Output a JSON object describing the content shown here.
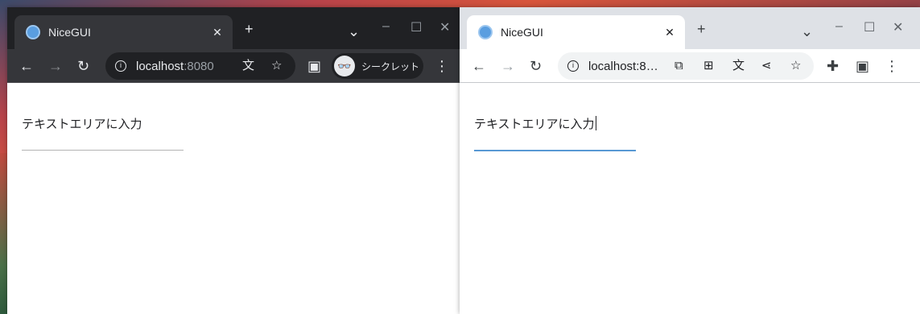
{
  "left_window": {
    "tab_title": "NiceGUI",
    "url_host": "localhost",
    "url_port": ":8080",
    "incognito_label": "シークレット",
    "textarea_label": "テキストエリアに入力"
  },
  "right_window": {
    "tab_title": "NiceGUI",
    "url_text": "localhost:8…",
    "textarea_label": "テキストエリアに入力"
  },
  "glyphs": {
    "new_tab": "+",
    "close": "✕",
    "tab_search": "⌄",
    "minimize": "–",
    "maximize": "☐",
    "back": "←",
    "forward": "→",
    "reload": "↻",
    "info": "i",
    "translate": "文",
    "star": "☆",
    "sidepanel": "▣",
    "incognito": "👓",
    "menu": "⋮",
    "cast": "⧉",
    "apps": "⊞",
    "share": "⋖",
    "extensions": "✚"
  },
  "colors": {
    "dark_frame": "#202124",
    "dark_toolbar": "#35363a",
    "light_frame": "#dee1e6",
    "focus_accent": "#5898d4"
  }
}
